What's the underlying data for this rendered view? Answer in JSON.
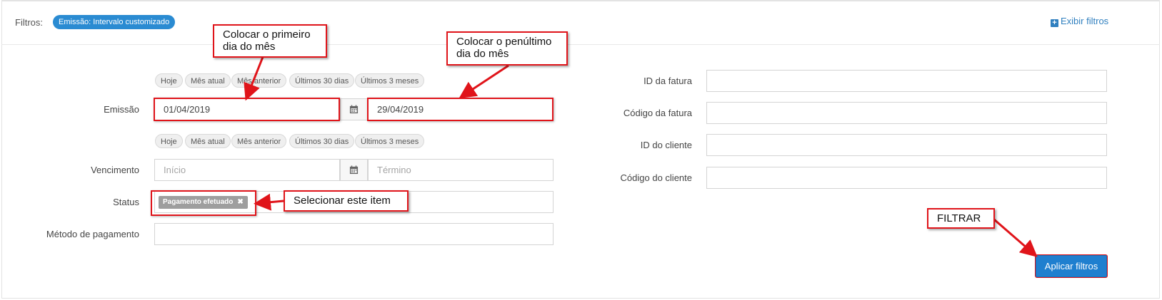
{
  "header": {
    "filters_label": "Filtros:",
    "active_filter_badge": "Emissão: Intervalo customizado",
    "show_filters_label": "Exibir filtros"
  },
  "quick_ranges": [
    "Hoje",
    "Mês atual",
    "Mês anterior",
    "Últimos 30 dias",
    "Últimos 3 meses"
  ],
  "form_left": {
    "emissao": {
      "label": "Emissão",
      "start_value": "01/04/2019",
      "end_value": "29/04/2019"
    },
    "vencimento": {
      "label": "Vencimento",
      "start_placeholder": "Início",
      "end_placeholder": "Término"
    },
    "status": {
      "label": "Status",
      "selected_tag": "Pagamento efetuado"
    },
    "metodo": {
      "label": "Método de pagamento",
      "value": ""
    }
  },
  "form_right": {
    "fields": [
      {
        "label": "ID da fatura",
        "value": ""
      },
      {
        "label": "Código da fatura",
        "value": ""
      },
      {
        "label": "ID do cliente",
        "value": ""
      },
      {
        "label": "Código do cliente",
        "value": ""
      }
    ]
  },
  "apply_button_label": "Aplicar filtros",
  "annotations": {
    "first_day": "Colocar o primeiro dia do mês",
    "penultimate_day": "Colocar o penúltimo dia do mês",
    "select_item": "Selecionar este item",
    "filter": "FILTRAR",
    "highlight_color": "#e0141a"
  },
  "icons": {
    "calendar": "calendar-icon",
    "plus": "plus-square-icon",
    "remove": "close-icon"
  },
  "colors": {
    "accent": "#1f7fcf",
    "badge": "#2a8bd2",
    "tag": "#9e9e9e"
  }
}
